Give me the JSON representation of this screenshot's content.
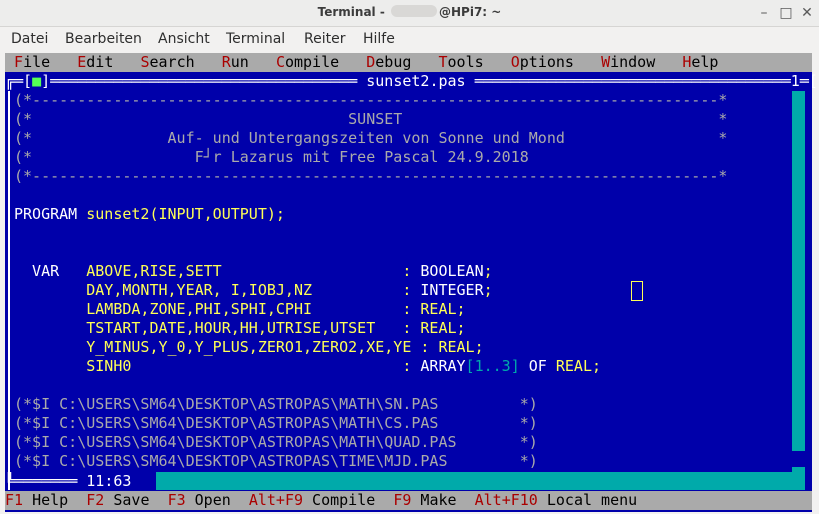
{
  "window": {
    "title_prefix": "Terminal - ",
    "title_suffix": "@HPi7: ~",
    "minimize": "–",
    "maximize": "□",
    "close": "✕"
  },
  "gtk_menu": [
    "Datei",
    "Bearbeiten",
    "Ansicht",
    "Terminal",
    "Reiter",
    "Hilfe"
  ],
  "ide_menu": [
    {
      "hot": "F",
      "rest": "ile"
    },
    {
      "hot": "E",
      "rest": "dit"
    },
    {
      "hot": "S",
      "rest": "earch"
    },
    {
      "hot": "R",
      "rest": "un"
    },
    {
      "hot": "C",
      "rest": "ompile"
    },
    {
      "hot": "D",
      "rest": "ebug"
    },
    {
      "hot": "T",
      "rest": "ools"
    },
    {
      "hot": "O",
      "rest": "ptions"
    },
    {
      "hot": "W",
      "rest": "indow"
    },
    {
      "hot": "H",
      "rest": "elp"
    }
  ],
  "editor": {
    "filename": "sunset2.pas",
    "window_number": "1",
    "close_box": "■",
    "zoom_box": "↕",
    "cursor_pos": "11:63",
    "lines": [
      "(*----------------------------------------------------------------------------*",
      "(*                                   SUNSET                                   *",
      "(*               Auf- und Untergangszeiten von Sonne und Mond                 *",
      "(*                  F┘r Lazarus mit Free Pascal 24.9.2018",
      "(*----------------------------------------------------------------------------*",
      "",
      "PROGRAM sunset2(INPUT,OUTPUT);",
      "",
      "",
      "  VAR   ABOVE,RISE,SETT                    : BOOLEAN;",
      "        DAY,MONTH,YEAR, I,IOBJ,NZ          : INTEGER;",
      "        LAMBDA,ZONE,PHI,SPHI,CPHI          : REAL;",
      "        TSTART,DATE,HOUR,HH,UTRISE,UTSET   : REAL;",
      "        Y_MINUS,Y_0,Y_PLUS,ZERO1,ZERO2,XE,YE : REAL;",
      "        SINH0                              : ARRAY[1..3] OF REAL;",
      "",
      "(*$I C:\\USERS\\SM64\\DESKTOP\\ASTROPAS\\MATH\\SN.PAS         *)",
      "(*$I C:\\USERS\\SM64\\DESKTOP\\ASTROPAS\\MATH\\CS.PAS         *)",
      "(*$I C:\\USERS\\SM64\\DESKTOP\\ASTROPAS\\MATH\\QUAD.PAS       *)",
      "(*$I C:\\USERS\\SM64\\DESKTOP\\ASTROPAS\\TIME\\MJD.PAS        *)"
    ]
  },
  "status": [
    {
      "key": "F1",
      "label": " Help"
    },
    {
      "key": "F2",
      "label": " Save"
    },
    {
      "key": "F3",
      "label": " Open"
    },
    {
      "key": "Alt+F9",
      "label": " Compile"
    },
    {
      "key": "F9",
      "label": " Make"
    },
    {
      "key": "Alt+F10",
      "label": " Local menu"
    }
  ],
  "colors": {
    "background": "#0000aa",
    "menubar": "#aaaaaa",
    "hotkey": "#aa0000",
    "keyword": "#ffffff",
    "identifier": "#ffff55",
    "comment": "#aaaaaa",
    "number": "#00aaaa"
  }
}
